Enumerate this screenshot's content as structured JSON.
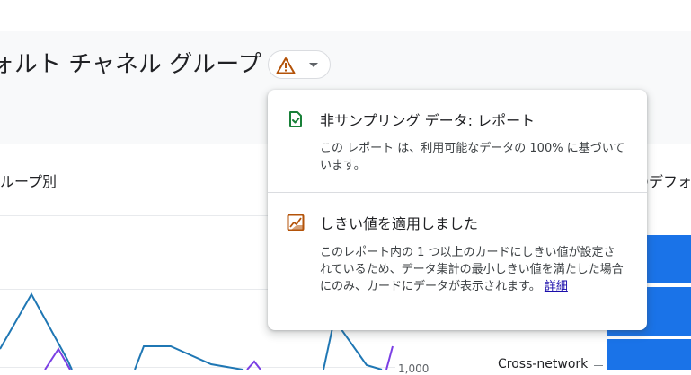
{
  "header": {
    "title": "ォルト チャネル グループ",
    "status_icon": "warning-triangle-icon",
    "status_color": "#b45309"
  },
  "cards": {
    "left_title": "ループ別",
    "right_title": "のデフォ"
  },
  "chart": {
    "axis_tick": "1,000",
    "legend_label": "Cross-network",
    "line_color_1": "#1f77b4",
    "line_color_2": "#7b3fe4",
    "bar_color": "#1a73e8"
  },
  "popup": {
    "sampling": {
      "icon": "check-document-icon",
      "heading": "非サンプリング データ: レポート",
      "body": "この レポート は、利用可能なデータの 100% に基づいています。"
    },
    "threshold": {
      "icon": "threshold-chart-icon",
      "heading": "しきい値を適用しました",
      "body": "このレポート内の 1 つ以上のカードにしきい値が設定されているため、データ集計の最小しきい値を満たした場合にのみ、カードにデータが表示されます。",
      "link": "詳細"
    }
  }
}
